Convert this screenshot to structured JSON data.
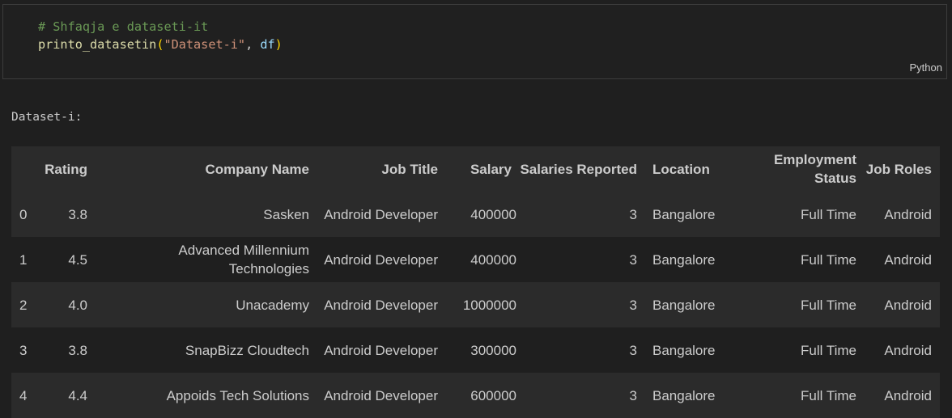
{
  "code_cell": {
    "comment": "# Shfaqja e dataseti-it",
    "fn_name": "printo_datasetin",
    "open_paren": "(",
    "string_arg": "\"Dataset-i\"",
    "comma": ", ",
    "var_arg": "df",
    "close_paren": ")",
    "language": "Python"
  },
  "output": {
    "title": "Dataset-i:",
    "table": {
      "columns": [
        "",
        "Rating",
        "Company Name",
        "Job Title",
        "Salary",
        "Salaries Reported",
        "Location",
        "Employment Status",
        "Job Roles"
      ],
      "rows": [
        [
          "0",
          "3.8",
          "Sasken",
          "Android Developer",
          "400000",
          "3",
          "Bangalore",
          "Full Time",
          "Android"
        ],
        [
          "1",
          "4.5",
          "Advanced Millennium Technologies",
          "Android Developer",
          "400000",
          "3",
          "Bangalore",
          "Full Time",
          "Android"
        ],
        [
          "2",
          "4.0",
          "Unacademy",
          "Android Developer",
          "1000000",
          "3",
          "Bangalore",
          "Full Time",
          "Android"
        ],
        [
          "3",
          "3.8",
          "SnapBizz Cloudtech",
          "Android Developer",
          "300000",
          "3",
          "Bangalore",
          "Full Time",
          "Android"
        ],
        [
          "4",
          "4.4",
          "Appoids Tech Solutions",
          "Android Developer",
          "600000",
          "3",
          "Bangalore",
          "Full Time",
          "Android"
        ]
      ]
    }
  },
  "colors": {
    "background": "#1f1f1f",
    "row_alt": "#2b2b2b",
    "comment": "#6a9955",
    "function": "#dcdcaa",
    "string": "#ce9178",
    "variable": "#9cdcfe",
    "bracket": "#ffd700"
  }
}
